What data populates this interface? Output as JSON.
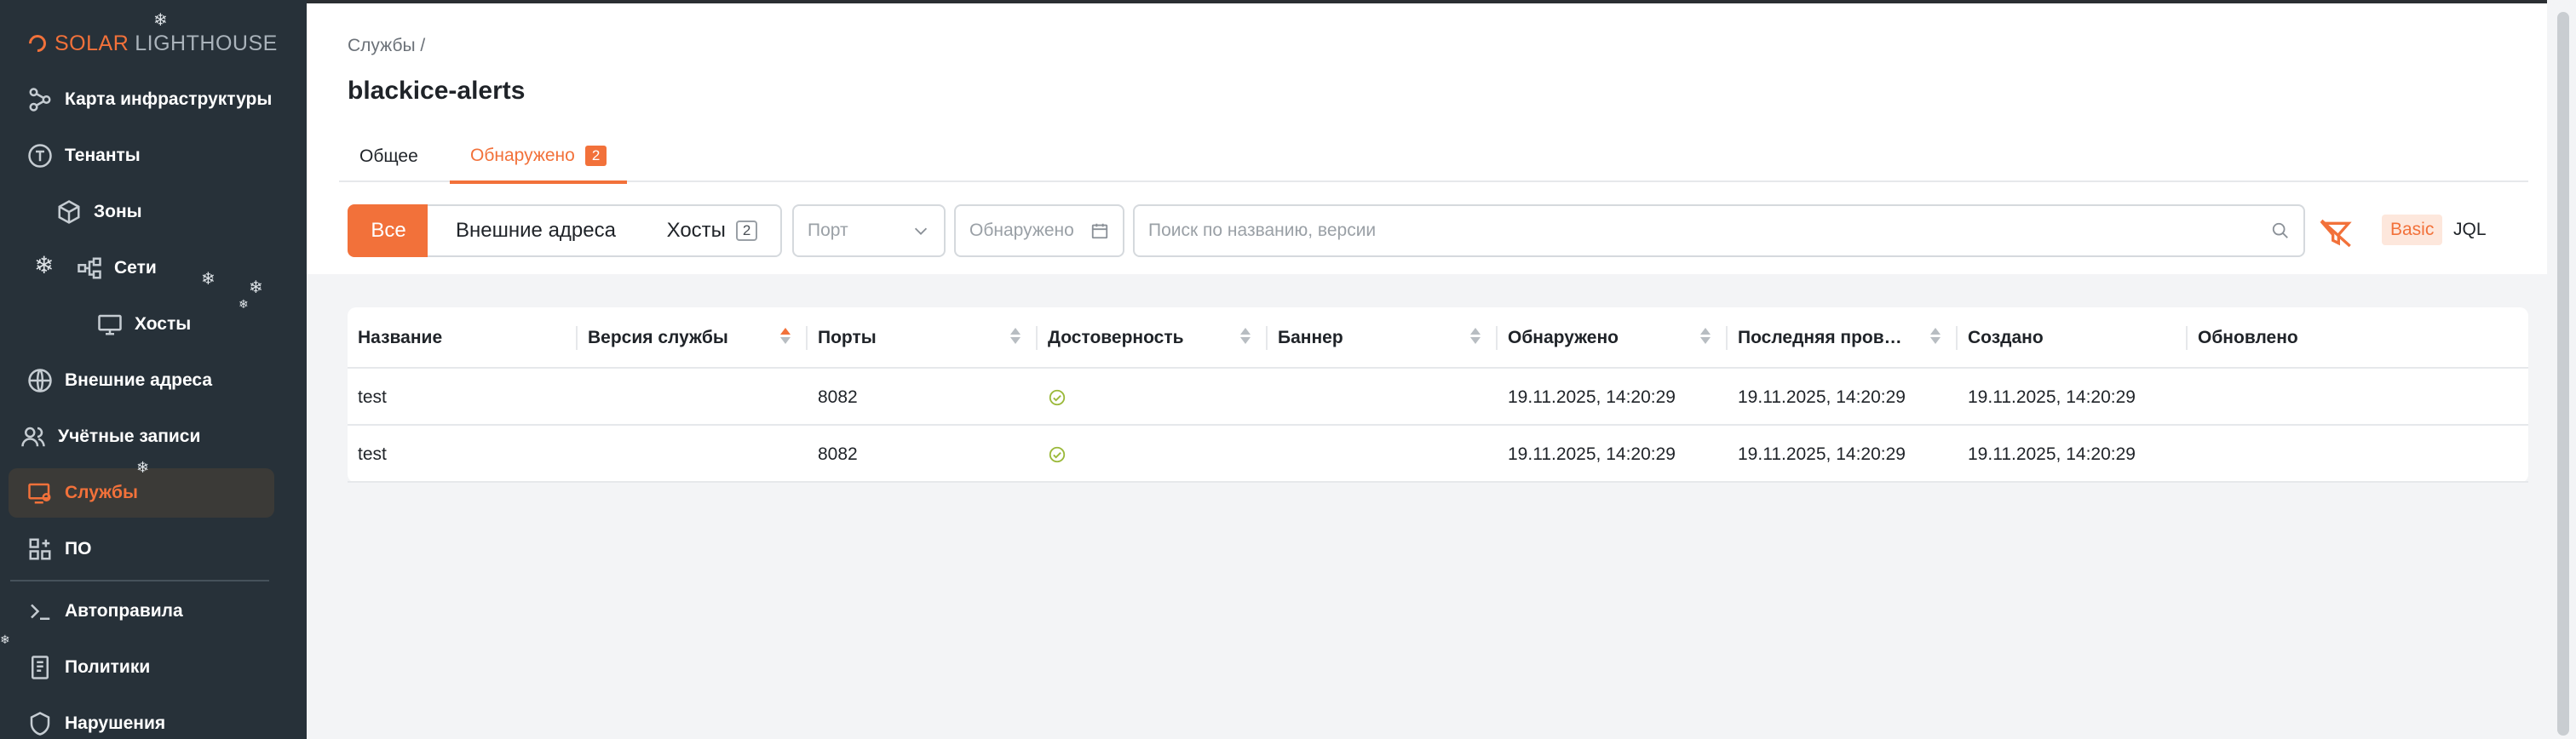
{
  "sidebar": {
    "logo": {
      "solar": "SOLAR",
      "rest": "LIGHTHOUSE"
    },
    "items": [
      {
        "label": "Карта инфраструктуры",
        "icon": "graph-icon"
      },
      {
        "label": "Тенанты",
        "icon": "tenant-icon"
      },
      {
        "label": "Зоны",
        "icon": "cube-icon"
      },
      {
        "label": "Сети",
        "icon": "network-icon"
      },
      {
        "label": "Хосты",
        "icon": "monitor-icon"
      },
      {
        "label": "Внешние адреса",
        "icon": "globe-icon"
      },
      {
        "label": "Учётные записи",
        "icon": "users-icon"
      },
      {
        "label": "Службы",
        "icon": "services-icon",
        "active": true
      },
      {
        "label": "ПО",
        "icon": "apps-icon"
      },
      {
        "label": "Автоправила",
        "icon": "terminal-icon"
      },
      {
        "label": "Политики",
        "icon": "document-icon"
      },
      {
        "label": "Нарушения",
        "icon": "shield-icon"
      }
    ]
  },
  "header": {
    "breadcrumb": "Службы /",
    "title": "blackice-alerts"
  },
  "tabs": {
    "general": "Общее",
    "found": "Обнаружено",
    "found_count": "2"
  },
  "toolbar": {
    "seg_all": "Все",
    "seg_external": "Внешние адреса",
    "seg_hosts": "Хосты",
    "hosts_count": "2",
    "port_placeholder": "Порт",
    "date_placeholder": "Обнаружено",
    "search_placeholder": "Поиск по названию, версии",
    "mode_basic": "Basic",
    "mode_jql": "JQL"
  },
  "table": {
    "columns": [
      "Название",
      "Версия службы",
      "Порты",
      "Достоверность",
      "Баннер",
      "Обнаружено",
      "Последняя пров…",
      "Создано",
      "Обновлено"
    ],
    "rows": [
      [
        "test",
        "",
        "8082",
        "",
        "",
        "19.11.2025, 14:20:29",
        "19.11.2025, 14:20:29",
        "19.11.2025, 14:20:29",
        ""
      ],
      [
        "test",
        "",
        "8082",
        "",
        "",
        "19.11.2025, 14:20:29",
        "19.11.2025, 14:20:29",
        "19.11.2025, 14:20:29",
        ""
      ]
    ]
  },
  "colors": {
    "accent": "#f2713a",
    "sidebar": "#273139",
    "ok": "#9bb93a"
  }
}
